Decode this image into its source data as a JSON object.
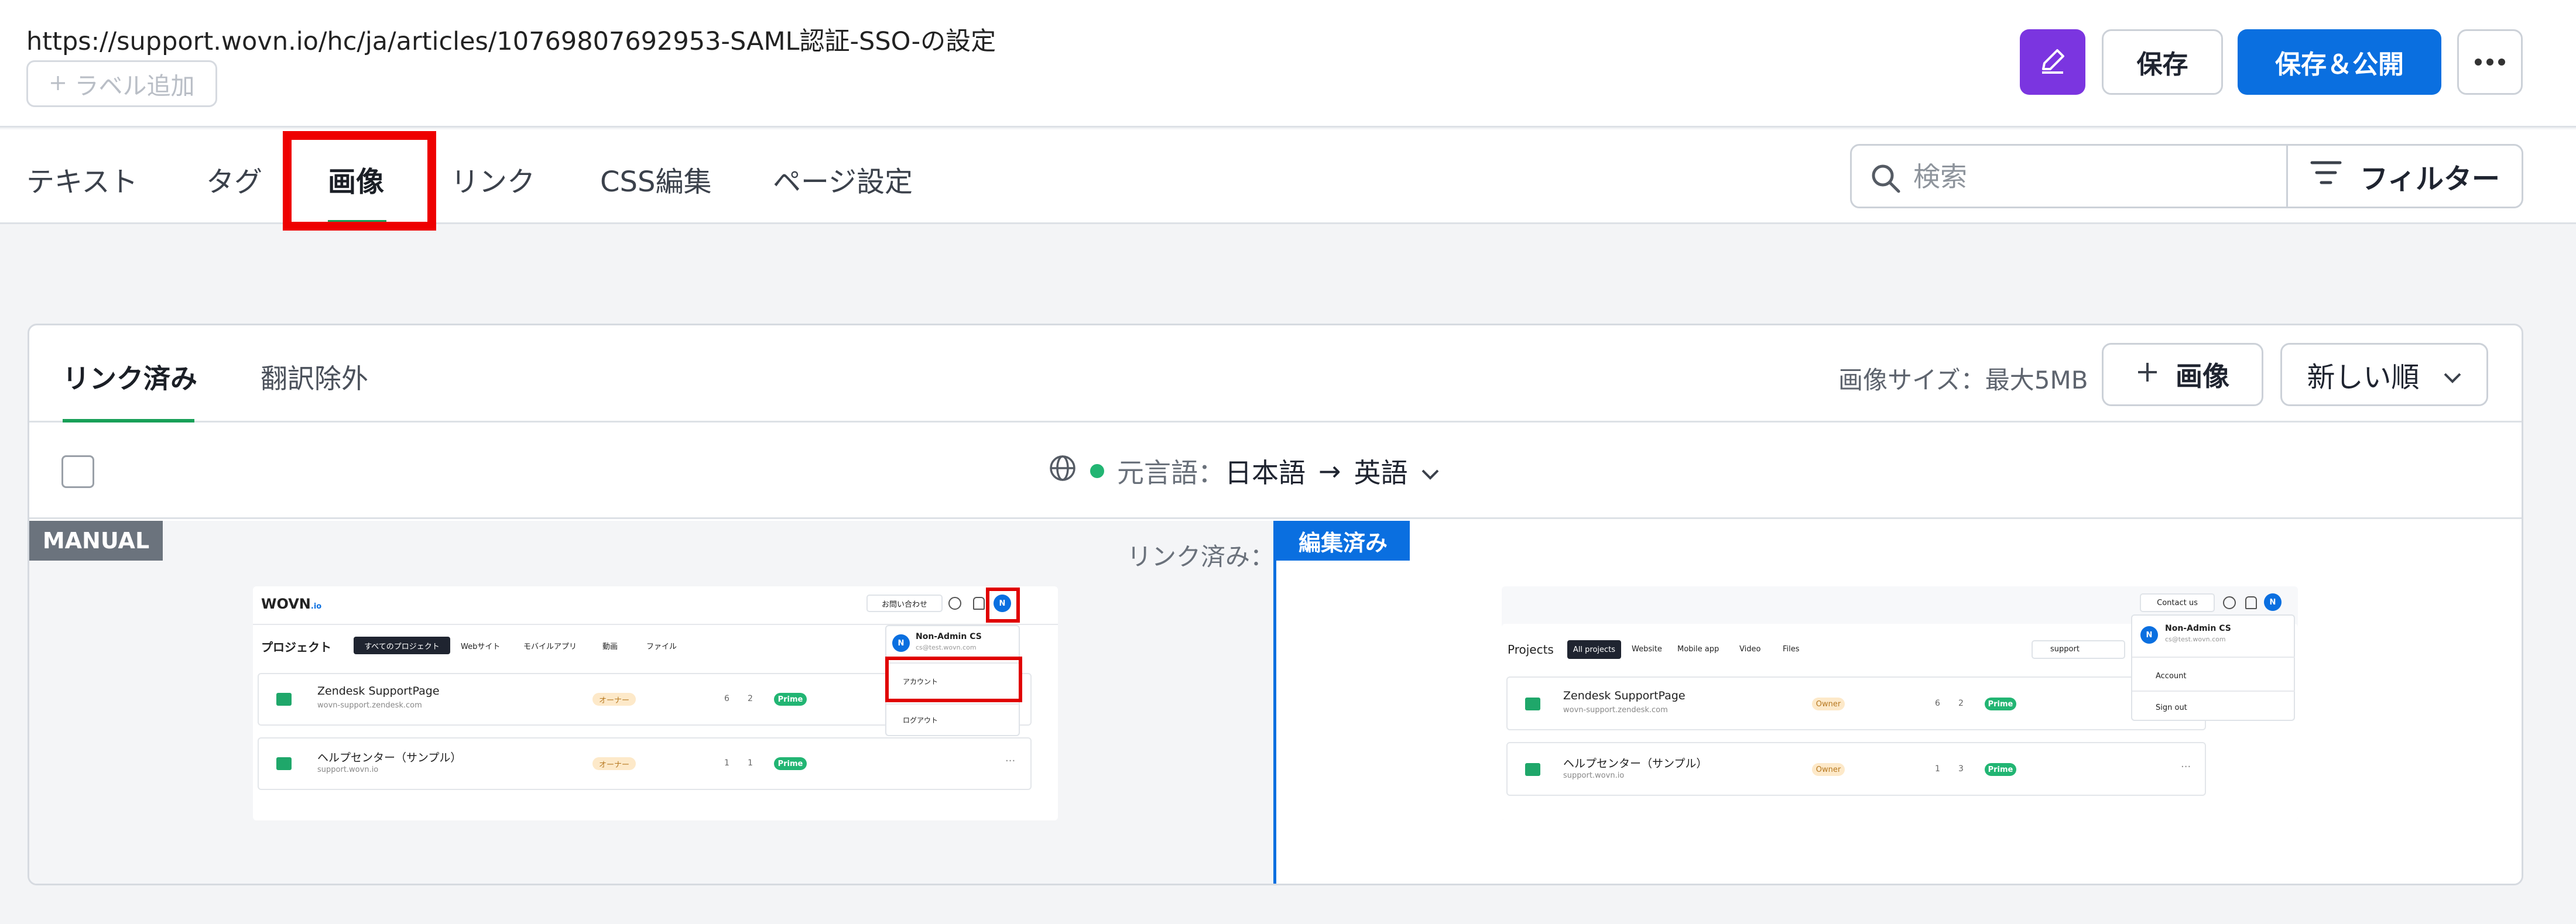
{
  "header": {
    "url": "https://support.wovn.io/hc/ja/articles/10769807692953-SAML認証-SSO-の設定",
    "label_add": "ラベル追加",
    "save_label": "保存",
    "publish_label": "保存＆公開"
  },
  "tabs": [
    {
      "label": "テキスト"
    },
    {
      "label": "タグ"
    },
    {
      "label": "画像",
      "active": true
    },
    {
      "label": "リンク"
    },
    {
      "label": "CSS編集"
    },
    {
      "label": "ページ設定"
    }
  ],
  "search": {
    "placeholder": "検索"
  },
  "filter_label": "フィルター",
  "panel": {
    "subtabs": [
      {
        "label": "リンク済み",
        "active": true
      },
      {
        "label": "翻訳除外"
      }
    ],
    "image_size": "画像サイズ：最大5MB",
    "add_image": "画像",
    "sort": "新しい順",
    "source_label": "元言語：",
    "source_lang": "日本語",
    "arrow": "→",
    "target_lang": "英語",
    "manual_badge": "MANUAL",
    "linked_label": "リンク済み：",
    "edited_badge": "編集済み"
  },
  "shot_ja": {
    "logo": "WOVN",
    "logo_suffix": ".io",
    "contact": "お問い合わせ",
    "avatar": "N",
    "projects_title": "プロジェクト",
    "filters": [
      "すべてのプロジェクト",
      "Webサイト",
      "モバイルアプリ",
      "動画",
      "ファイル"
    ],
    "menu_name": "Non-Admin CS",
    "menu_email": "cs@test.wovn.com",
    "menu_account": "アカウント",
    "menu_logout": "ログアウト",
    "rows": [
      {
        "name": "Zendesk SupportPage",
        "domain": "wovn-support.zendesk.com",
        "role": "オーナー",
        "pages": "6",
        "langs": "2",
        "plan": "Prime"
      },
      {
        "name": "ヘルプセンター（サンプル）",
        "domain": "support.wovn.io",
        "role": "オーナー",
        "pages": "1",
        "langs": "1",
        "plan": "Prime"
      }
    ]
  },
  "shot_en": {
    "contact": "Contact us",
    "avatar": "N",
    "projects_title": "Projects",
    "filters": [
      "All projects",
      "Website",
      "Mobile app",
      "Video",
      "Files"
    ],
    "search_value": "support",
    "menu_name": "Non-Admin CS",
    "menu_email": "cs@test.wovn.com",
    "menu_account": "Account",
    "menu_logout": "Sign out",
    "rows": [
      {
        "name": "Zendesk SupportPage",
        "domain": "wovn-support.zendesk.com",
        "role": "Owner",
        "pages": "6",
        "langs": "2",
        "plan": "Prime"
      },
      {
        "name": "ヘルプセンター（サンプル）",
        "domain": "support.wovn.io",
        "role": "Owner",
        "pages": "1",
        "langs": "3",
        "plan": "Prime"
      }
    ]
  },
  "colors": {
    "accent": "#0a6fe0",
    "edit_purple": "#7b35e0",
    "success": "#18a058",
    "highlight_red": "#ee0000"
  }
}
